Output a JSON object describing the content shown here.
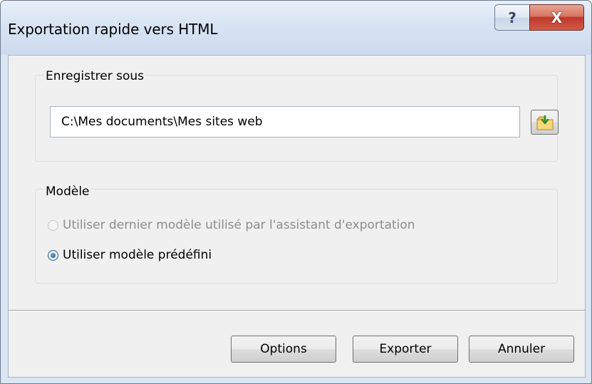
{
  "window": {
    "title": "Exportation rapide vers HTML",
    "help_glyph": "?",
    "close_glyph": "X",
    "icons": {
      "help": "help-icon",
      "close": "close-icon"
    }
  },
  "save_group": {
    "label": "Enregistrer sous",
    "path_value": "C:\\Mes documents\\Mes sites web",
    "browse_icon": "folder-browse-icon"
  },
  "template_group": {
    "label": "Modèle",
    "options": [
      {
        "label": "Utiliser dernier modèle utilisé par l'assistant d'exportation",
        "selected": false,
        "enabled": false
      },
      {
        "label": "Utiliser modèle prédéfini",
        "selected": true,
        "enabled": true
      }
    ]
  },
  "buttons": {
    "options": "Options",
    "export": "Exporter",
    "cancel": "Annuler"
  },
  "colors": {
    "titlebar": "#d8e4f3",
    "client": "#f0f0f0",
    "close_button": "#c0392b",
    "disabled_text": "#8c8c8c"
  }
}
